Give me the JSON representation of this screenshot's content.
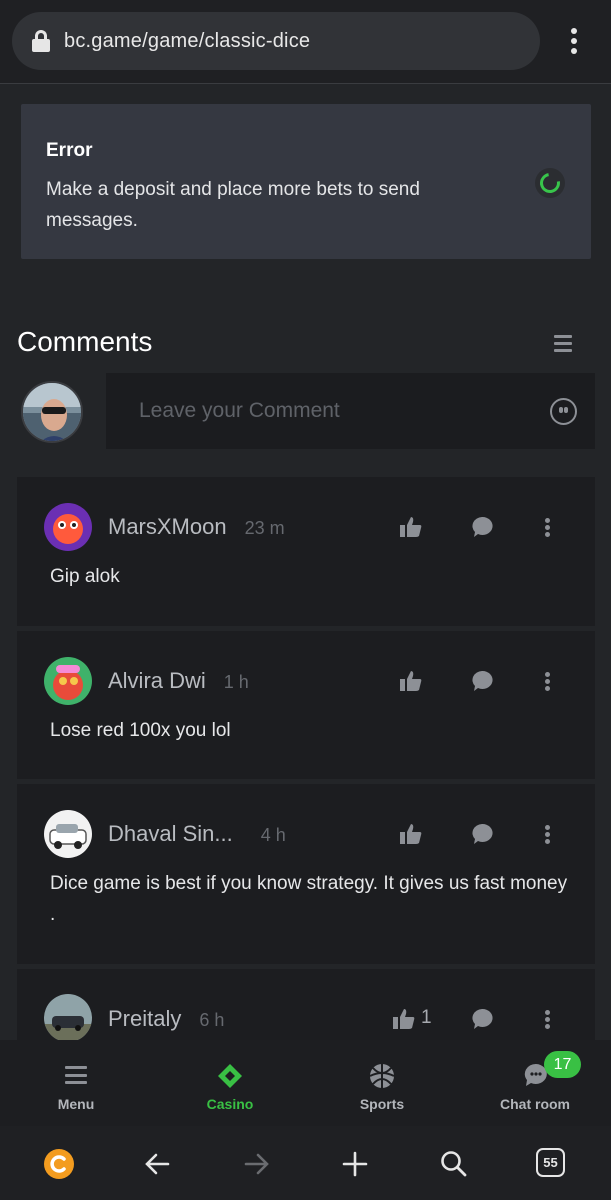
{
  "browser": {
    "url": "bc.game/game/classic-dice",
    "tab_count": "55"
  },
  "error": {
    "title": "Error",
    "message": "Make a deposit and place more bets to send messages."
  },
  "comments": {
    "title": "Comments",
    "input_placeholder": "Leave your Comment",
    "items": [
      {
        "user": "MarsXMoon",
        "time": "23 m",
        "text": "Gip alok",
        "likes": ""
      },
      {
        "user": "Alvira Dwi",
        "time": "1 h",
        "text": "Lose red 100x you lol",
        "likes": ""
      },
      {
        "user": "Dhaval Sin...",
        "time": "4 h",
        "text": "Dice game is best if you know strategy. It gives us fast money .",
        "likes": ""
      },
      {
        "user": "Preitaly",
        "time": "6 h",
        "text": "",
        "likes": "1"
      }
    ]
  },
  "nav": {
    "menu": "Menu",
    "casino": "Casino",
    "sports": "Sports",
    "chat": "Chat room",
    "chat_badge": "17"
  },
  "colors": {
    "accent_green": "#39c044",
    "card_bg": "#1c1d20",
    "page_bg": "#232528"
  }
}
